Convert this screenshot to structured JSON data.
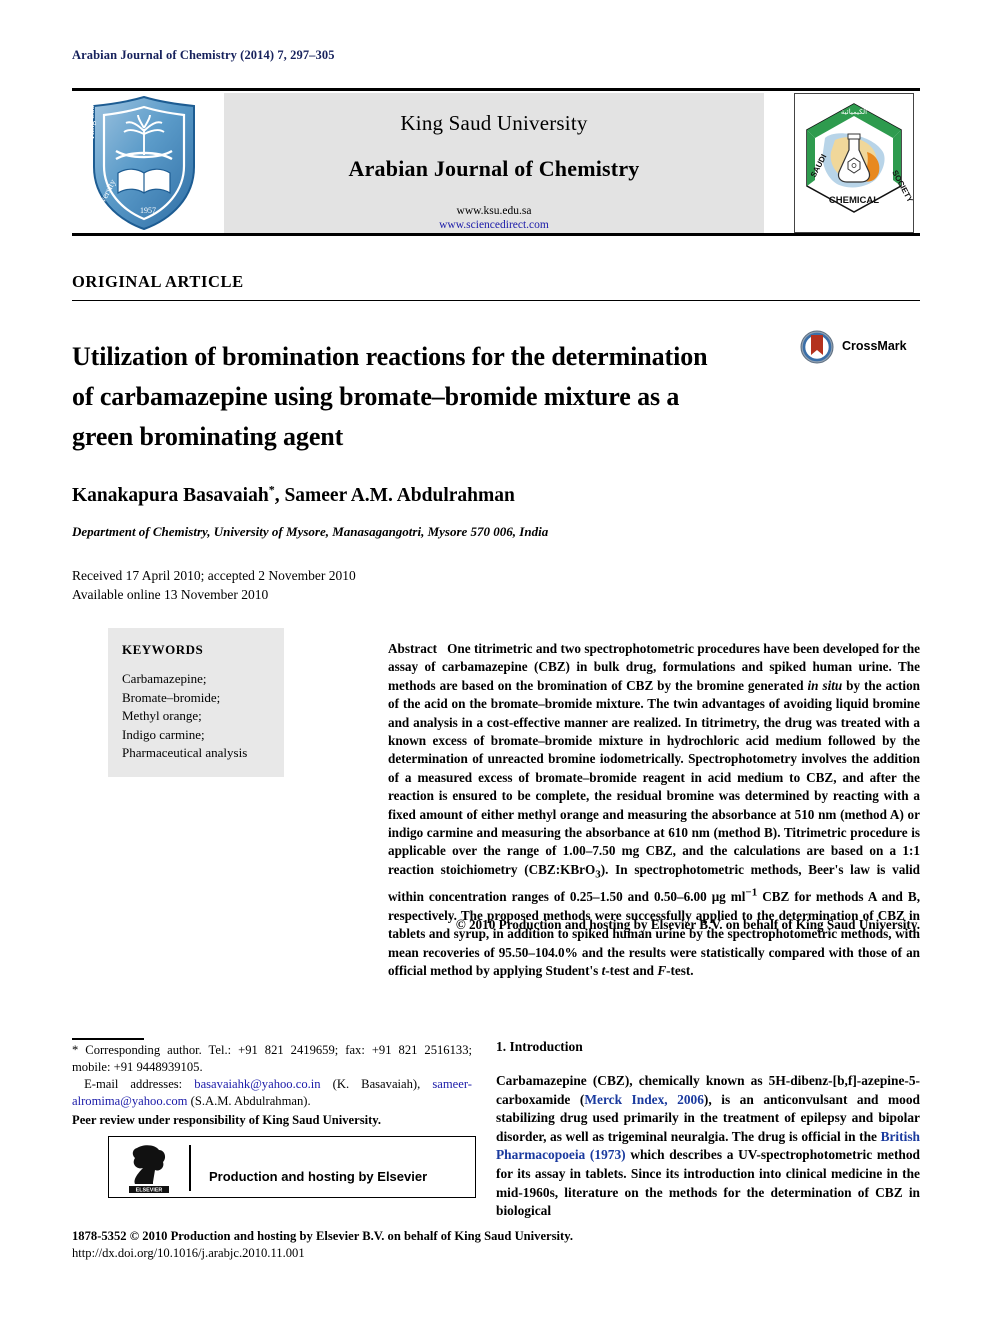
{
  "running_head": "Arabian Journal of Chemistry (2014) 7, 297–305",
  "banner": {
    "publisher": "King Saud University",
    "journal_title": "Arabian Journal of Chemistry",
    "url_primary": "www.ksu.edu.sa",
    "url_secondary": "www.sciencedirect.com",
    "left_logo_name": "king-saud-university-shield",
    "left_logo_text": "King Saud University 1957",
    "right_logo_name": "saudi-chemical-society-hexagon",
    "right_logo_text": "SAUDI CHEMICAL SOCIETY"
  },
  "article_type": "ORIGINAL ARTICLE",
  "title": "Utilization of bromination reactions for the determination of carbamazepine using bromate–bromide mixture as a green brominating agent",
  "crossmark": {
    "label": "CrossMark",
    "icon": "crossmark-badge-icon"
  },
  "authors": "Kanakapura Basavaiah *, Sameer A.M. Abdulrahman",
  "authors_plain": "Kanakapura Basavaiah , Sameer A.M. Abdulrahman",
  "corresponding_marker": "*",
  "affiliation": "Department of Chemistry, University of Mysore, Manasagangotri, Mysore 570 006, India",
  "dates": {
    "received_accepted": "Received 17 April 2010; accepted 2 November 2010",
    "available_online": "Available online 13 November 2010"
  },
  "keywords": {
    "heading": "KEYWORDS",
    "items": [
      "Carbamazepine;",
      "Bromate–bromide;",
      "Methyl orange;",
      "Indigo carmine;",
      "Pharmaceutical analysis"
    ]
  },
  "abstract": {
    "label": "Abstract",
    "text": "One titrimetric and two spectrophotometric procedures have been developed for the assay of carbamazepine (CBZ) in bulk drug, formulations and spiked human urine. The methods are based on the bromination of CBZ by the bromine generated in situ by the action of the acid on the bromate–bromide mixture. The twin advantages of avoiding liquid bromine and analysis in a cost-effective manner are realized. In titrimetry, the drug was treated with a known excess of bromate–bromide mixture in hydrochloric acid medium followed by the determination of unreacted bromine iodometrically. Spectrophotometry involves the addition of a measured excess of bromate–bromide reagent in acid medium to CBZ, and after the reaction is ensured to be complete, the residual bromine was determined by reacting with a fixed amount of either methyl orange and measuring the absorbance at 510 nm (method A) or indigo carmine and measuring the absorbance at 610 nm (method B). Titrimetric procedure is applicable over the range of 1.00–7.50 mg CBZ, and the calculations are based on a 1:1 reaction stoichiometry (CBZ:KBrO3). In spectrophotometric methods, Beer's law is valid within concentration ranges of 0.25–1.50 and 0.50–6.00 μg ml−1 CBZ for methods A and B, respectively. The proposed methods were successfully applied to the determination of CBZ in tablets and syrup, in addition to spiked human urine by the spectrophotometric methods, with mean recoveries of 95.50–104.0% and the results were statistically compared with those of an official method by applying Student's t-test and F-test.",
    "italic_terms": [
      "in situ",
      "t-test",
      "F-test"
    ],
    "subscript_formula": "KBrO3",
    "superscript_unit": "μg ml−1",
    "copyright": "© 2010 Production and hosting by Elsevier B.V. on behalf of King Saud University."
  },
  "footnote": {
    "corresponding_line": "* Corresponding author. Tel.: +91 821 2419659; fax: +91 821 2516133; mobile: +91 9448939105.",
    "email_label": "E-mail addresses:",
    "email1": "basavaiahk@yahoo.co.in",
    "email1_owner": "(K. Basavaiah),",
    "email2": "sameer-alromima@yahoo.com",
    "email2_owner": "(S.A.M. Abdulrahman).",
    "peer_review": "Peer review under responsibility of King Saud University.",
    "elsevier_box_text": "Production and hosting by Elsevier",
    "elsevier_logo_name": "elsevier-tree-logo",
    "elsevier_wordmark": "ELSEVIER",
    "issn_line": "1878-5352 © 2010 Production and hosting by Elsevier B.V. on behalf of King Saud University.",
    "doi": "http://dx.doi.org/10.1016/j.arabjc.2010.11.001"
  },
  "introduction": {
    "heading": "1. Introduction",
    "para_1_a": "Carbamazepine (CBZ), chemically known as 5H-dibenz-[b,f]-azepine-5-carboxamide (",
    "cite_1": "Merck Index, 2006",
    "para_1_b": "), is an anticonvulsant and mood stabilizing drug used primarily in the treatment of epilepsy and bipolar disorder, as well as trigeminal neuralgia. The drug is official in the ",
    "cite_2": "British Pharmacopoeia (1973)",
    "para_1_c": " which describes a UV-spectrophotometric method for its assay in tablets. Since its introduction into clinical medicine in the mid-1960s, literature on the methods for the determination of CBZ in biological"
  },
  "colors": {
    "runhead_navy": "#16215c",
    "link_blue": "#1a1aa8",
    "cite_blue": "#1a3a9e",
    "banner_gray": "#e3e3e3",
    "keyword_gray": "#e8e8e8",
    "crossmark_red": "#b4321e",
    "scs_green": "#2e9b4e"
  }
}
